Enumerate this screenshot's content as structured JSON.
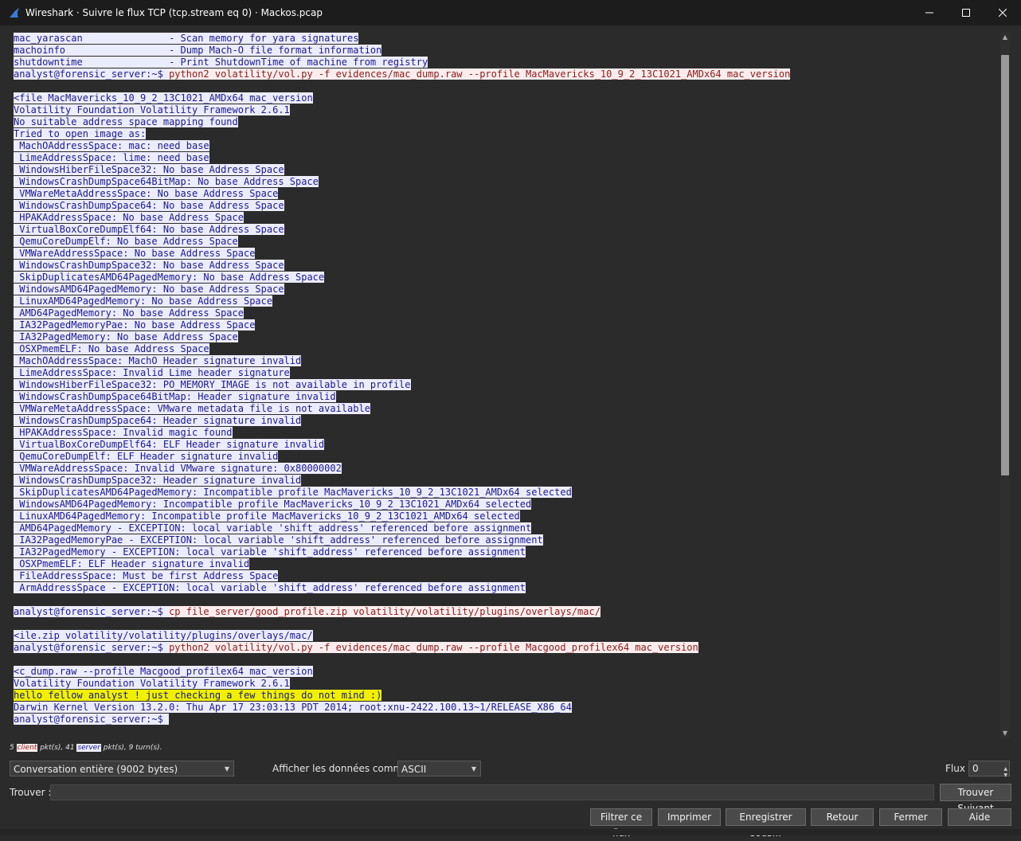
{
  "window": {
    "title": "Wireshark · Suivre le flux TCP (tcp.stream eq 0) · Mackos.pcap",
    "controls": [
      "minimize",
      "maximize",
      "close"
    ]
  },
  "stream_lines": [
    [
      {
        "t": "mac_yarascan               - Scan memory for yara signatures",
        "k": "srv"
      }
    ],
    [
      {
        "t": "machoinfo                  - Dump Mach-O file format information",
        "k": "srv"
      }
    ],
    [
      {
        "t": "shutdowntime               - Print ShutdownTime of machine from registry",
        "k": "srv"
      }
    ],
    [
      {
        "t": "analyst@forensic_server:~$ ",
        "k": "srv"
      },
      {
        "t": "python2 volatility/vol.py -f evidences/mac_dump.raw --profile MacMavericks_10_9_2_13C1021_AMDx64 mac_version",
        "k": "cli"
      }
    ],
    [],
    [
      {
        "t": "<file MacMavericks_10_9_2_13C1021_AMDx64 mac_version",
        "k": "srv"
      }
    ],
    [
      {
        "t": "Volatility Foundation Volatility Framework 2.6.1",
        "k": "srv"
      }
    ],
    [
      {
        "t": "No suitable address space mapping found",
        "k": "srv"
      }
    ],
    [
      {
        "t": "Tried to open image as:",
        "k": "srv"
      }
    ],
    [
      {
        "t": " MachOAddressSpace: mac: need base",
        "k": "srv"
      }
    ],
    [
      {
        "t": " LimeAddressSpace: lime: need base",
        "k": "srv"
      }
    ],
    [
      {
        "t": " WindowsHiberFileSpace32: No base Address Space",
        "k": "srv"
      }
    ],
    [
      {
        "t": " WindowsCrashDumpSpace64BitMap: No base Address Space",
        "k": "srv"
      }
    ],
    [
      {
        "t": " VMWareMetaAddressSpace: No base Address Space",
        "k": "srv"
      }
    ],
    [
      {
        "t": " WindowsCrashDumpSpace64: No base Address Space",
        "k": "srv"
      }
    ],
    [
      {
        "t": " HPAKAddressSpace: No base Address Space",
        "k": "srv"
      }
    ],
    [
      {
        "t": " VirtualBoxCoreDumpElf64: No base Address Space",
        "k": "srv"
      }
    ],
    [
      {
        "t": " QemuCoreDumpElf: No base Address Space",
        "k": "srv"
      }
    ],
    [
      {
        "t": " VMWareAddressSpace: No base Address Space",
        "k": "srv"
      }
    ],
    [
      {
        "t": " WindowsCrashDumpSpace32: No base Address Space",
        "k": "srv"
      }
    ],
    [
      {
        "t": " SkipDuplicatesAMD64PagedMemory: No base Address Space",
        "k": "srv"
      }
    ],
    [
      {
        "t": " WindowsAMD64PagedMemory: No base Address Space",
        "k": "srv"
      }
    ],
    [
      {
        "t": " LinuxAMD64PagedMemory: No base Address Space",
        "k": "srv"
      }
    ],
    [
      {
        "t": " AMD64PagedMemory: No base Address Space",
        "k": "srv"
      }
    ],
    [
      {
        "t": " IA32PagedMemoryPae: No base Address Space",
        "k": "srv"
      }
    ],
    [
      {
        "t": " IA32PagedMemory: No base Address Space",
        "k": "srv"
      }
    ],
    [
      {
        "t": " OSXPmemELF: No base Address Space",
        "k": "srv"
      }
    ],
    [
      {
        "t": " MachOAddressSpace: MachO Header signature invalid",
        "k": "srv"
      }
    ],
    [
      {
        "t": " LimeAddressSpace: Invalid Lime header signature",
        "k": "srv"
      }
    ],
    [
      {
        "t": " WindowsHiberFileSpace32: PO_MEMORY_IMAGE is not available in profile",
        "k": "srv"
      }
    ],
    [
      {
        "t": " WindowsCrashDumpSpace64BitMap: Header signature invalid",
        "k": "srv"
      }
    ],
    [
      {
        "t": " VMWareMetaAddressSpace: VMware metadata file is not available",
        "k": "srv"
      }
    ],
    [
      {
        "t": " WindowsCrashDumpSpace64: Header signature invalid",
        "k": "srv"
      }
    ],
    [
      {
        "t": " HPAKAddressSpace: Invalid magic found",
        "k": "srv"
      }
    ],
    [
      {
        "t": " VirtualBoxCoreDumpElf64: ELF Header signature invalid",
        "k": "srv"
      }
    ],
    [
      {
        "t": " QemuCoreDumpElf: ELF Header signature invalid",
        "k": "srv"
      }
    ],
    [
      {
        "t": " VMWareAddressSpace: Invalid VMware signature: 0x80000002",
        "k": "srv"
      }
    ],
    [
      {
        "t": " WindowsCrashDumpSpace32: Header signature invalid",
        "k": "srv"
      }
    ],
    [
      {
        "t": " SkipDuplicatesAMD64PagedMemory: Incompatible profile MacMavericks_10_9_2_13C1021_AMDx64 selected",
        "k": "srv"
      }
    ],
    [
      {
        "t": " WindowsAMD64PagedMemory: Incompatible profile MacMavericks_10_9_2_13C1021_AMDx64 selected",
        "k": "srv"
      }
    ],
    [
      {
        "t": " LinuxAMD64PagedMemory: Incompatible profile MacMavericks_10_9_2_13C1021_AMDx64 selected",
        "k": "srv"
      }
    ],
    [
      {
        "t": " AMD64PagedMemory - EXCEPTION: local variable 'shift_address' referenced before assignment",
        "k": "srv"
      }
    ],
    [
      {
        "t": " IA32PagedMemoryPae - EXCEPTION: local variable 'shift_address' referenced before assignment",
        "k": "srv"
      }
    ],
    [
      {
        "t": " IA32PagedMemory - EXCEPTION: local variable 'shift_address' referenced before assignment",
        "k": "srv"
      }
    ],
    [
      {
        "t": " OSXPmemELF: ELF Header signature invalid",
        "k": "srv"
      }
    ],
    [
      {
        "t": " FileAddressSpace: Must be first Address Space",
        "k": "srv"
      }
    ],
    [
      {
        "t": " ArmAddressSpace - EXCEPTION: local variable 'shift_address' referenced before assignment",
        "k": "srv"
      }
    ],
    [],
    [
      {
        "t": "analyst@forensic_server:~$ ",
        "k": "srv"
      },
      {
        "t": "cp file_server/good_profile.zip volatility/volatility/plugins/overlays/mac/",
        "k": "cli"
      }
    ],
    [],
    [
      {
        "t": "<ile.zip volatility/volatility/plugins/overlays/mac/",
        "k": "srv"
      }
    ],
    [
      {
        "t": "analyst@forensic_server:~$ ",
        "k": "srv"
      },
      {
        "t": "python2 volatility/vol.py -f evidences/mac_dump.raw --profile Macgood_profilex64 mac_version",
        "k": "cli"
      }
    ],
    [],
    [
      {
        "t": "<c_dump.raw --profile Macgood_profilex64 mac_version",
        "k": "srv"
      }
    ],
    [
      {
        "t": "Volatility Foundation Volatility Framework 2.6.1",
        "k": "srv"
      }
    ],
    [
      {
        "t": "hello fellow analyst ! just checking a few things do not mind :)",
        "k": "hl"
      }
    ],
    [
      {
        "t": "Darwin Kernel Version 13.2.0: Thu Apr 17 23:03:13 PDT 2014; root:xnu-2422.100.13~1/RELEASE_X86_64",
        "k": "srv"
      }
    ],
    [
      {
        "t": "analyst@forensic_server:~$ ",
        "k": "srv"
      }
    ]
  ],
  "status": {
    "client_count": "5",
    "client_label": "client",
    "middle": " pkt(s), 41 ",
    "server_label": "server",
    "tail": " pkt(s), 9 turn(s)."
  },
  "conversation_select": "Conversation entière (9002 bytes)",
  "show_as_label": "Afficher les données comme",
  "show_as_value": "ASCII",
  "stream_label": "Flux",
  "stream_value": "0",
  "find_label": "Trouver :",
  "find_value": "",
  "buttons": {
    "find_next": "Trouver Suivant",
    "filter_out": "Filtrer ce flux",
    "print": "Imprimer",
    "save_as": "Enregistrer sous...",
    "back": "Retour",
    "close": "Fermer",
    "help": "Aide"
  },
  "colors": {
    "server_bg": "#ececff",
    "server_fg": "#1a1a8c",
    "client_bg": "#fbeded",
    "client_fg": "#8b1a1a",
    "highlight_bg": "#f0f000"
  }
}
